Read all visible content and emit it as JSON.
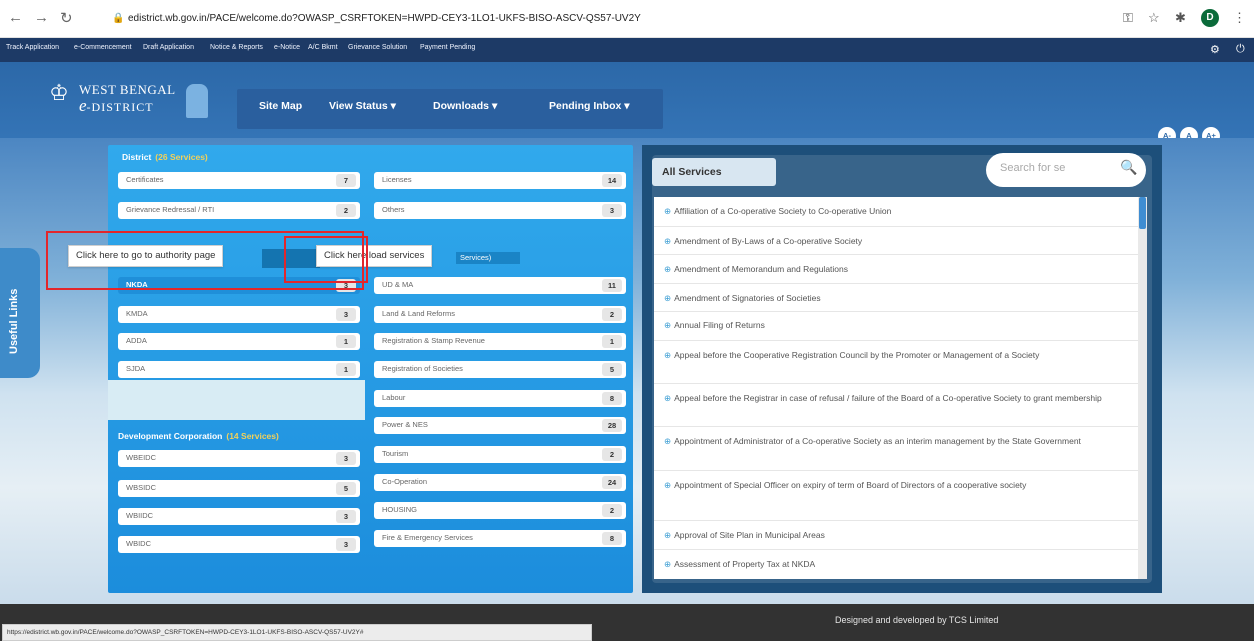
{
  "browser": {
    "url": "edistrict.wb.gov.in/PACE/welcome.do?OWASP_CSRFTOKEN=HWPD-CEY3-1LO1-UKFS-BISO-ASCV-QS57-UV2Y",
    "profile_initial": "D"
  },
  "topbar": {
    "links": [
      "Track Application",
      "e-Commencement",
      "Draft Application",
      "Notice & Reports",
      "e-Notice",
      "A/C Bkmt",
      "Grievance Solution",
      "Payment Pending"
    ]
  },
  "header": {
    "logo_line1": "WEST BENGAL",
    "logo_e": "e",
    "logo_line2": "-DISTRICT",
    "menu": [
      "Site Map",
      "View Status",
      "Downloads",
      "Pending Inbox"
    ],
    "caret": "▾",
    "font_buttons": [
      "A-",
      "A",
      "A+"
    ]
  },
  "useful_links": "Useful Links",
  "district": {
    "title": "District",
    "count_label": "(26 Services)",
    "items": [
      {
        "label": "Certificates",
        "count": "7"
      },
      {
        "label": "Licenses",
        "count": "14"
      },
      {
        "label": "Grievance Redressal / RTI",
        "count": "2"
      },
      {
        "label": "Others",
        "count": "3"
      }
    ]
  },
  "authority": {
    "items": [
      {
        "label": "NKDA",
        "count": "3"
      },
      {
        "label": "KMDA",
        "count": "3"
      },
      {
        "label": "ADDA",
        "count": "1"
      },
      {
        "label": "SJDA",
        "count": "1"
      }
    ]
  },
  "department": {
    "items": [
      {
        "label": "UD & MA",
        "count": "11"
      },
      {
        "label": "Land & Land Reforms",
        "count": "2"
      },
      {
        "label": "Registration & Stamp Revenue",
        "count": "1"
      },
      {
        "label": "Registration of Societies",
        "count": "5"
      },
      {
        "label": "Labour",
        "count": "8"
      },
      {
        "label": "Power & NES",
        "count": "28"
      },
      {
        "label": "Tourism",
        "count": "2"
      },
      {
        "label": "Co-Operation",
        "count": "24"
      },
      {
        "label": "HOUSING",
        "count": "2"
      },
      {
        "label": "Fire & Emergency Services",
        "count": "8"
      }
    ],
    "tab_text": "Services)"
  },
  "development": {
    "title": "Development Corporation",
    "count_label": "(14 Services)",
    "items": [
      {
        "label": "WBEIDC",
        "count": "3"
      },
      {
        "label": "WBSIDC",
        "count": "5"
      },
      {
        "label": "WBIIDC",
        "count": "3"
      },
      {
        "label": "WBIDC",
        "count": "3"
      }
    ]
  },
  "tooltips": {
    "authority": "Click here to go to authority page",
    "download": "Click here load services"
  },
  "services": {
    "tab": "All Services",
    "search_placeholder": "Search for se",
    "items": [
      "Affiliation of a Co-operative Society to Co-operative Union",
      "Amendment of By-Laws of a Co-operative Society",
      "Amendment of Memorandum and Regulations",
      "Amendment of Signatories of Societies",
      "Annual Filing of Returns",
      "Appeal before the Cooperative Registration Council by the Promoter or Management of a Society",
      "Appeal before the Registrar in case of refusal / failure of the Board of a Co-operative Society to grant membership",
      "Appointment of Administrator of a Co-operative Society as an interim management by the State Government",
      "Appointment of Special Officer on expiry of term of Board of Directors of a cooperative society",
      "Approval of Site Plan in Municipal Areas",
      "Assessment of Property Tax at NKDA"
    ]
  },
  "footer": {
    "credit": "Designed and developed by TCS Limited",
    "status_url": "https://edistrict.wb.gov.in/PACE/welcome.do?OWASP_CSRFTOKEN=HWPD-CEY3-1LO1-UKFS-BISO-ASCV-QS57-UV2Y#"
  },
  "colors": {
    "header": "#2c68a8",
    "panel": "#1c8ddc",
    "footer": "#323232",
    "highlight": "#e3262b"
  }
}
